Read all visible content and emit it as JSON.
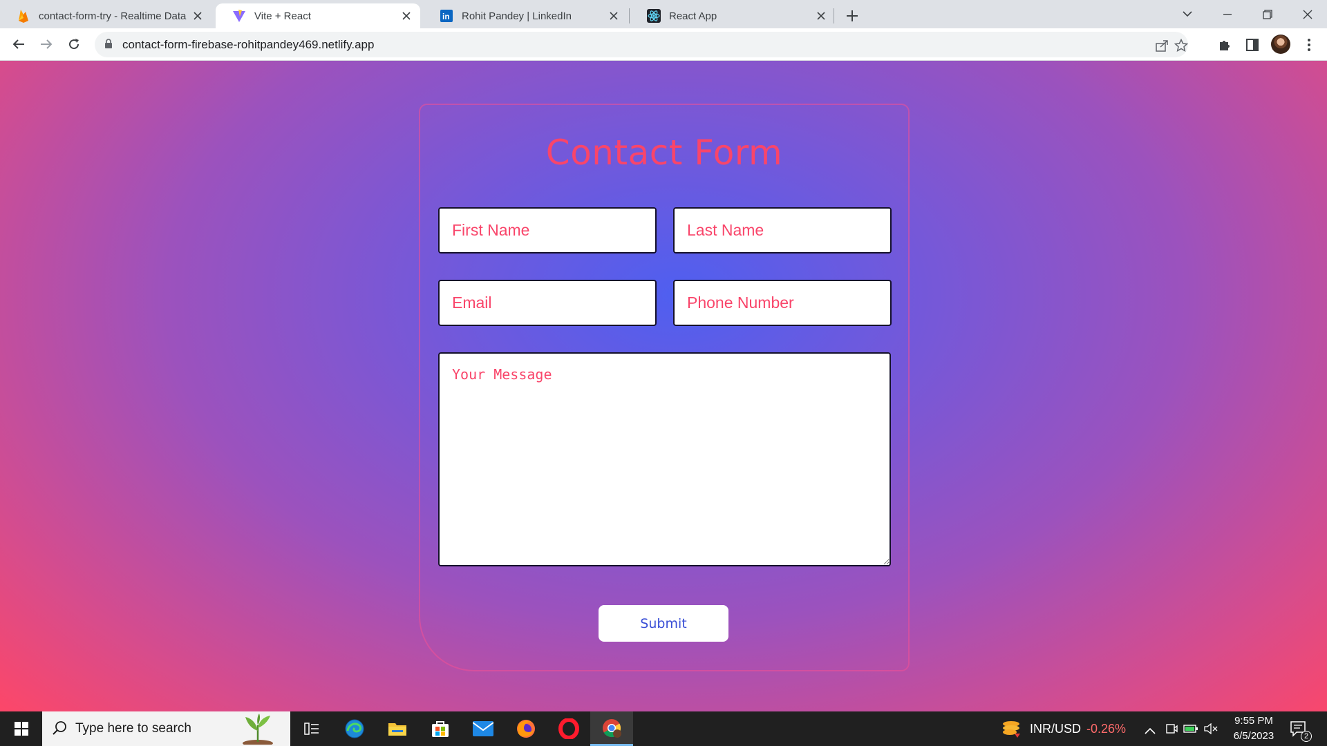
{
  "browser": {
    "tabs": [
      {
        "title": "contact-form-try - Realtime Data",
        "favicon": "firebase-icon",
        "active": false
      },
      {
        "title": "Vite + React",
        "favicon": "vite-icon",
        "active": true
      },
      {
        "title": "Rohit Pandey | LinkedIn",
        "favicon": "linkedin-icon",
        "active": false
      },
      {
        "title": "React App",
        "favicon": "react-icon",
        "active": false
      }
    ],
    "url": "contact-form-firebase-rohitpandey469.netlify.app"
  },
  "form": {
    "title": "Contact Form",
    "first_name_placeholder": "First Name",
    "last_name_placeholder": "Last Name",
    "email_placeholder": "Email",
    "phone_placeholder": "Phone Number",
    "message_placeholder": "Your Message",
    "submit_label": "Submit"
  },
  "taskbar": {
    "search_placeholder": "Type here to search",
    "ticker_name": "INR/USD",
    "ticker_change": "-0.26%",
    "time": "9:55 PM",
    "date": "6/5/2023",
    "notification_count": "2"
  },
  "colors": {
    "accent": "#f9456a",
    "submit_text": "#3a4fd6",
    "ticker_negative": "#ff6b6b"
  }
}
